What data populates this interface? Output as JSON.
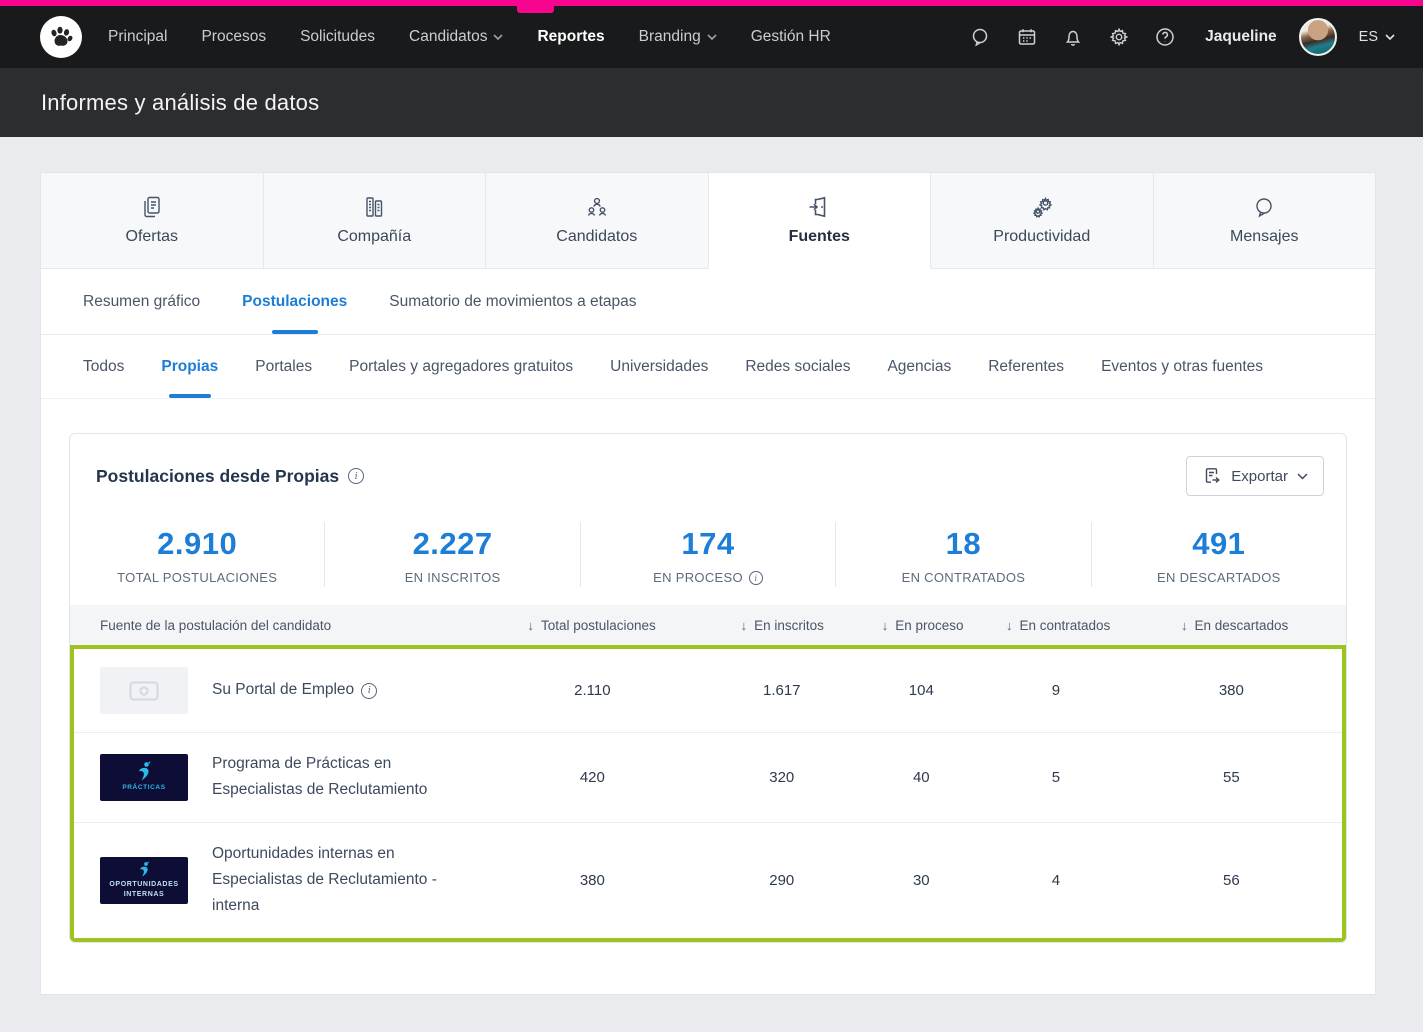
{
  "brand": {
    "accent_pink": "#f7058f",
    "link_blue": "#1c7ed6",
    "highlight_green": "#9dc41e"
  },
  "navbar": {
    "items": [
      {
        "label": "Principal"
      },
      {
        "label": "Procesos"
      },
      {
        "label": "Solicitudes"
      },
      {
        "label": "Candidatos"
      },
      {
        "label": "Reportes"
      },
      {
        "label": "Branding"
      },
      {
        "label": "Gestión HR"
      }
    ],
    "active_item": "Reportes",
    "user_name": "Jaqueline",
    "language": "ES"
  },
  "header": {
    "title": "Informes y análisis de datos"
  },
  "report_tabs": [
    {
      "label": "Ofertas"
    },
    {
      "label": "Compañía"
    },
    {
      "label": "Candidatos"
    },
    {
      "label": "Fuentes"
    },
    {
      "label": "Productividad"
    },
    {
      "label": "Mensajes"
    }
  ],
  "report_tabs_active": "Fuentes",
  "sub_tabs": [
    {
      "label": "Resumen gráfico"
    },
    {
      "label": "Postulaciones"
    },
    {
      "label": "Sumatorio de movimientos a etapas"
    }
  ],
  "sub_tabs_active": "Postulaciones",
  "filter_tabs": [
    {
      "label": "Todos"
    },
    {
      "label": "Propias"
    },
    {
      "label": "Portales"
    },
    {
      "label": "Portales y agregadores gratuitos"
    },
    {
      "label": "Universidades"
    },
    {
      "label": "Redes sociales"
    },
    {
      "label": "Agencias"
    },
    {
      "label": "Referentes"
    },
    {
      "label": "Eventos y otras fuentes"
    }
  ],
  "filter_tabs_active": "Propias",
  "card": {
    "title": "Postulaciones desde Propias",
    "export_label": "Exportar",
    "stats": [
      {
        "value": "2.910",
        "label": "TOTAL POSTULACIONES"
      },
      {
        "value": "2.227",
        "label": "EN INSCRITOS"
      },
      {
        "value": "174",
        "label": "EN PROCESO"
      },
      {
        "value": "18",
        "label": "EN CONTRATADOS"
      },
      {
        "value": "491",
        "label": "EN DESCARTADOS"
      }
    ],
    "table": {
      "source_header": "Fuente de la postulación del candidato",
      "sort_arrow": "↓",
      "columns": [
        {
          "label": "Total postulaciones"
        },
        {
          "label": "En inscritos"
        },
        {
          "label": "En proceso"
        },
        {
          "label": "En contratados"
        },
        {
          "label": "En descartados"
        }
      ],
      "rows": [
        {
          "name": "Su Portal de Empleo",
          "logo_caption": "",
          "values": [
            "2.110",
            "1.617",
            "104",
            "9",
            "380"
          ]
        },
        {
          "name": "Programa de Prácticas en Especialistas de Reclutamiento",
          "logo_caption": "PRÁCTICAS",
          "values": [
            "420",
            "320",
            "40",
            "5",
            "55"
          ]
        },
        {
          "name": "Oportunidades internas en Especialistas de Reclutamiento - interna",
          "logo_caption": "OPORTUNIDADES INTERNAS",
          "values": [
            "380",
            "290",
            "30",
            "4",
            "56"
          ]
        }
      ]
    }
  }
}
